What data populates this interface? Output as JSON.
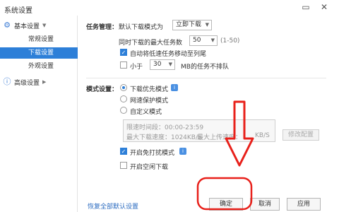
{
  "window": {
    "title": "系统设置",
    "minimize_glyph": "▭",
    "close_glyph": "✕"
  },
  "sidebar": {
    "groups": [
      {
        "label": "基本设置",
        "icon": "gear-icon",
        "expanded": true,
        "items": [
          {
            "label": "常规设置"
          },
          {
            "label": "下载设置",
            "active": true
          },
          {
            "label": "外观设置"
          }
        ]
      },
      {
        "label": "高级设置",
        "icon": "info-icon",
        "expanded": false
      }
    ]
  },
  "task": {
    "section_label": "任务管理：",
    "default_mode_label": "默认下载模式为",
    "default_mode_value": "立即下载",
    "max_tasks_label": "同时下载的最大任务数",
    "max_tasks_value": "50",
    "max_tasks_range": "(1-50)",
    "auto_move_label": "自动将低速任务移动至列尾",
    "auto_move_checked": true,
    "min_size_prefix": "小于",
    "min_size_value": "30",
    "min_size_suffix": "MB的任务不排队",
    "min_size_checked": false
  },
  "mode": {
    "section_label": "模式设置：",
    "options": [
      {
        "label": "下载优先模式",
        "selected": true
      },
      {
        "label": "网速保护模式",
        "selected": false
      },
      {
        "label": "自定义模式",
        "selected": false
      }
    ],
    "custom": {
      "period": "限速时间段：00:00-23:59",
      "max_download": "最大下载速度：1024KB/S",
      "max_upload": "最大上传速度：",
      "upload_value": "KB/S",
      "modify_button": "修改配置"
    },
    "no_disturb_label": "开启免打扰模式",
    "no_disturb_checked": true,
    "idle_download_label": "开启空闲下载",
    "idle_download_checked": false
  },
  "footer": {
    "restore_link": "恢复全部默认设置",
    "ok": "确定",
    "cancel": "取消",
    "apply": "应用"
  },
  "annotation": {
    "arrow_color": "#e8201a",
    "circle_color": "#e8201a"
  }
}
